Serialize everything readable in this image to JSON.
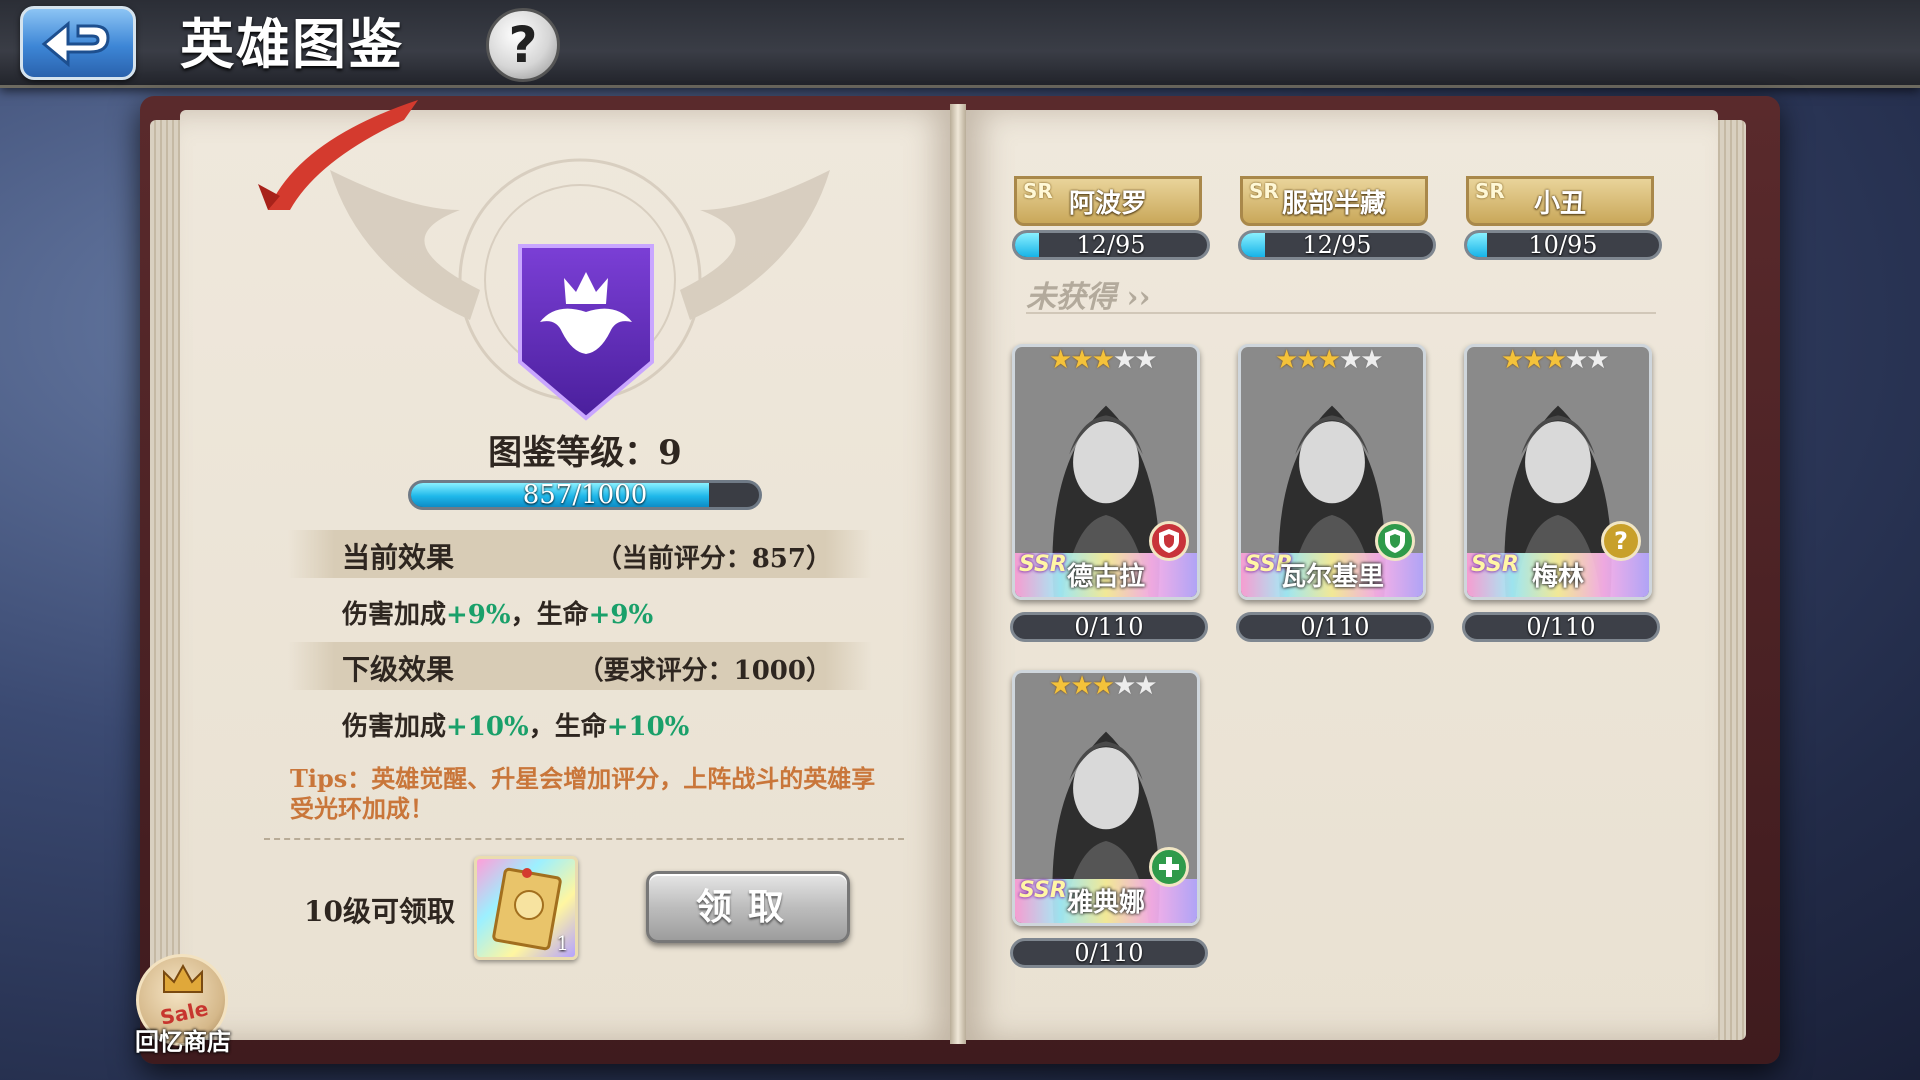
{
  "header": {
    "title": "英雄图鉴",
    "help_label": "?"
  },
  "left_page": {
    "collection_level_label": "图鉴等级：9",
    "level_progress": {
      "text": "857/1000",
      "fraction": 0.857
    },
    "current_effect": {
      "title": "当前效果",
      "score_text": "（当前评分：857）",
      "damage_label": "伤害加成",
      "damage_value": "+9%",
      "separator": "，",
      "hp_label": "生命",
      "hp_value": "+9%"
    },
    "next_effect": {
      "title": "下级效果",
      "score_text": "（要求评分：1000）",
      "damage_label": "伤害加成",
      "damage_value": "+10%",
      "separator": "，",
      "hp_label": "生命",
      "hp_value": "+10%"
    },
    "tips": "Tips：英雄觉醒、升星会增加评分，上阵战斗的英雄享受光环加成！",
    "reward": {
      "label": "10级可领取",
      "item_count": "1",
      "claim_label": "领取"
    }
  },
  "shop": {
    "badge": "Sale",
    "label": "回忆商店"
  },
  "right_page": {
    "owned_heroes": [
      {
        "rarity": "SR",
        "name": "阿波罗",
        "progress_text": "12/95",
        "progress": 0.126
      },
      {
        "rarity": "SR",
        "name": "服部半藏",
        "progress_text": "12/95",
        "progress": 0.126
      },
      {
        "rarity": "SR",
        "name": "小丑",
        "progress_text": "10/95",
        "progress": 0.105
      }
    ],
    "unobtained_label": "未获得",
    "unobtained_heroes": [
      {
        "rarity": "SSR",
        "name": "德古拉",
        "stars": 3,
        "max_stars": 5,
        "progress_text": "0/110",
        "class_icon": "shield-icon",
        "class_color": "#c8333a"
      },
      {
        "rarity": "SSR",
        "name": "瓦尔基里",
        "stars": 3,
        "max_stars": 5,
        "progress_text": "0/110",
        "class_icon": "shield-icon",
        "class_color": "#2f9a4a"
      },
      {
        "rarity": "SSR",
        "name": "梅林",
        "stars": 3,
        "max_stars": 5,
        "progress_text": "0/110",
        "class_icon": "question-icon",
        "class_color": "#c8a02a"
      },
      {
        "rarity": "SSR",
        "name": "雅典娜",
        "stars": 3,
        "max_stars": 5,
        "progress_text": "0/110",
        "class_icon": "cross-icon",
        "class_color": "#2f9a4a"
      }
    ]
  },
  "colors": {
    "accent_cyan": "#1fb8ea",
    "bonus_green": "#1aa06a",
    "tips_orange": "#c9763a"
  }
}
